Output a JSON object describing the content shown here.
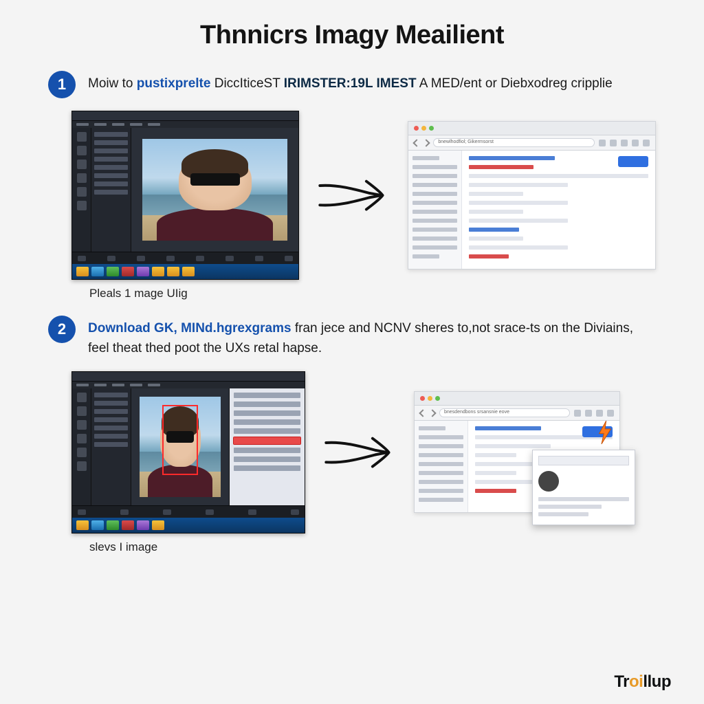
{
  "title": "Thnnicrs Imagy Meailient",
  "steps": [
    {
      "number": "1",
      "text_lead": "Moiw to ",
      "text_hl1": "pustixprelte",
      "text_mid": " DiccIticeST ",
      "text_hl2": "IRIMSTER:19L IMEST",
      "text_tail": " A MED/ent or Diebxodreg cripplie",
      "left_caption": "Pleals 1 mage UIig",
      "browser_url": "bnewlhodfiol; Gikermsorst"
    },
    {
      "number": "2",
      "text_hl1": "Download GK, MINd.hgrexgrams",
      "text_tail": " fran jece and NCNV sheres to,not srace-ts on the Diviains, feel theat thed poot the UXs retal hapse.",
      "left_caption": "slevs I image",
      "browser_url": "bnesdendbons srsansnie eove"
    }
  ],
  "brand": "Troillup"
}
